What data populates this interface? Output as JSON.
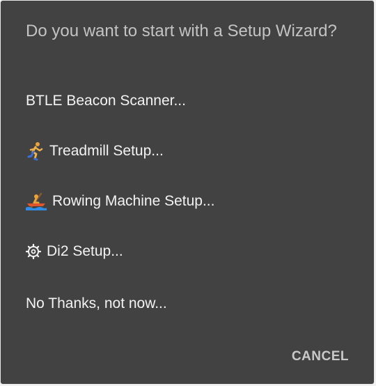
{
  "dialog": {
    "title": "Do you want to start with a Setup Wizard?",
    "options": [
      {
        "label": "BTLE Beacon Scanner...",
        "icon": ""
      },
      {
        "label": "Treadmill Setup...",
        "icon": "runner-icon"
      },
      {
        "label": "Rowing Machine Setup...",
        "icon": "rowing-boat-icon"
      },
      {
        "label": "Di2 Setup...",
        "icon": "gear-icon"
      },
      {
        "label": "No Thanks, not now...",
        "icon": ""
      }
    ],
    "cancel_label": "CANCEL"
  },
  "colors": {
    "dialog_background": "#424242",
    "title_text": "#c3c3c3",
    "option_text": "#f3f3f3",
    "cancel_text": "#c9c9c9"
  }
}
